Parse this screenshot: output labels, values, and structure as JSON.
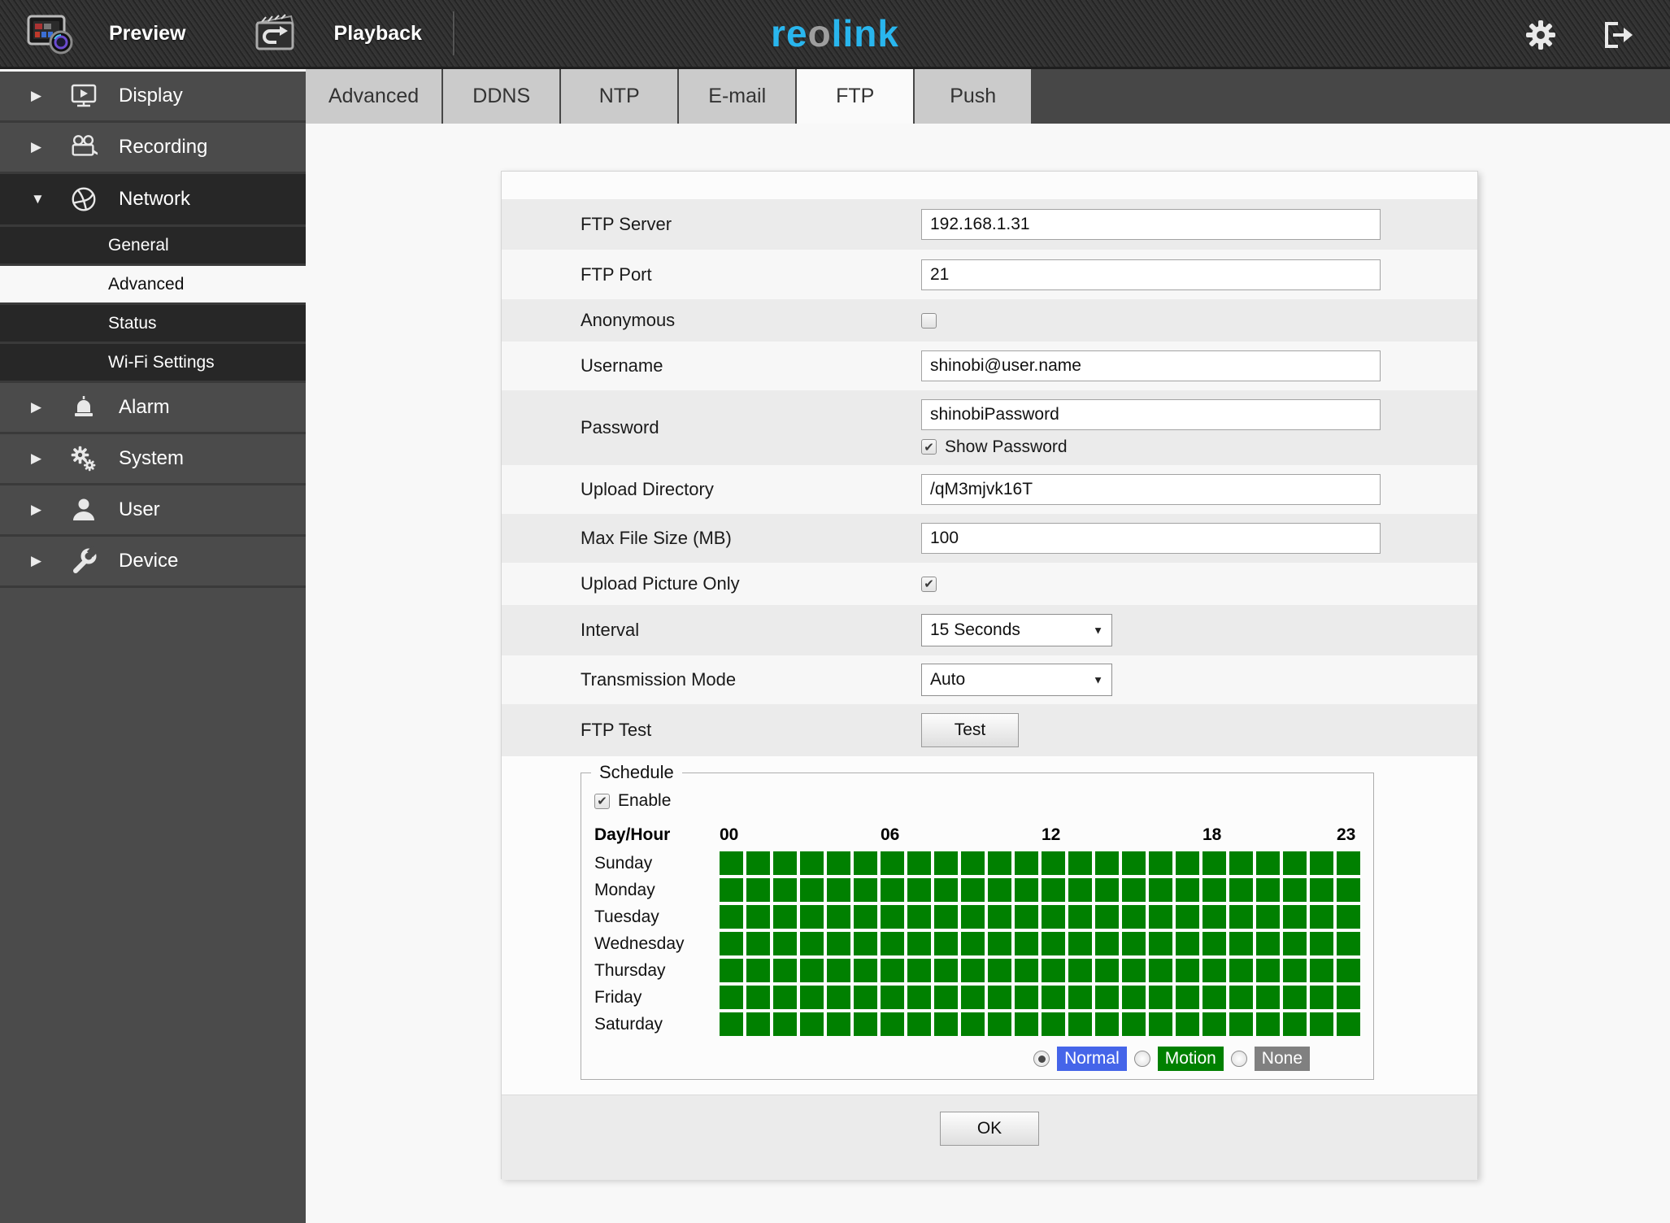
{
  "top_bar": {
    "menus": [
      {
        "label": "Preview",
        "icon": "preview-icon"
      },
      {
        "label": "Playback",
        "icon": "playback-icon"
      }
    ],
    "logo": {
      "pre": "re",
      "mid": "o",
      "post": "link"
    },
    "accent_color": "#29b6ee"
  },
  "sidebar": {
    "items": [
      {
        "label": "Display",
        "icon": "display-icon",
        "state": "collapsed"
      },
      {
        "label": "Recording",
        "icon": "recording-icon",
        "state": "collapsed"
      },
      {
        "label": "Network",
        "icon": "network-icon",
        "state": "expanded",
        "children": [
          {
            "label": "General",
            "selected": false
          },
          {
            "label": "Advanced",
            "selected": true
          },
          {
            "label": "Status",
            "selected": false
          },
          {
            "label": "Wi-Fi Settings",
            "selected": false
          }
        ]
      },
      {
        "label": "Alarm",
        "icon": "alarm-icon",
        "state": "collapsed"
      },
      {
        "label": "System",
        "icon": "system-icon",
        "state": "collapsed"
      },
      {
        "label": "User",
        "icon": "user-icon",
        "state": "collapsed"
      },
      {
        "label": "Device",
        "icon": "device-icon",
        "state": "collapsed"
      }
    ]
  },
  "tabs": [
    {
      "label": "Advanced",
      "active": false
    },
    {
      "label": "DDNS",
      "active": false
    },
    {
      "label": "NTP",
      "active": false
    },
    {
      "label": "E-mail",
      "active": false
    },
    {
      "label": "FTP",
      "active": true
    },
    {
      "label": "Push",
      "active": false
    }
  ],
  "form": {
    "rows": [
      {
        "id": "ftp-server",
        "label": "FTP Server",
        "type": "input",
        "value": "192.168.1.31"
      },
      {
        "id": "ftp-port",
        "label": "FTP Port",
        "type": "input",
        "value": "21"
      },
      {
        "id": "anonymous",
        "label": "Anonymous",
        "type": "checkbox",
        "checked": false
      },
      {
        "id": "username",
        "label": "Username",
        "type": "input",
        "value": "shinobi@user.name"
      },
      {
        "id": "password",
        "label": "Password",
        "type": "input-check",
        "value": "shinobiPassword",
        "check_label": "Show Password",
        "checked": true
      },
      {
        "id": "upload-directory",
        "label": "Upload Directory",
        "type": "input",
        "value": "/qM3mjvk16T"
      },
      {
        "id": "max-file-size",
        "label": "Max File Size (MB)",
        "type": "input",
        "value": "100"
      },
      {
        "id": "upload-picture-only",
        "label": "Upload Picture Only",
        "type": "checkbox",
        "checked": true
      },
      {
        "id": "interval",
        "label": "Interval",
        "type": "select",
        "value": "15 Seconds"
      },
      {
        "id": "transmission-mode",
        "label": "Transmission Mode",
        "type": "select",
        "value": "Auto"
      },
      {
        "id": "ftp-test",
        "label": "FTP Test",
        "type": "button",
        "button_label": "Test"
      }
    ],
    "ok_label": "OK"
  },
  "schedule": {
    "legend": "Schedule",
    "enable_label": "Enable",
    "enable_checked": true,
    "header": "Day/Hour",
    "hours": [
      {
        "label": "00",
        "col": 0
      },
      {
        "label": "06",
        "col": 6
      },
      {
        "label": "12",
        "col": 12
      },
      {
        "label": "18",
        "col": 18
      },
      {
        "label": "23",
        "col": 23
      }
    ],
    "days": [
      "Sunday",
      "Monday",
      "Tuesday",
      "Wednesday",
      "Thursday",
      "Friday",
      "Saturday"
    ],
    "grid": {
      "rows": 7,
      "cols": 24,
      "fill_mode": "Motion",
      "cell_color": "#008000"
    },
    "modes": [
      {
        "label": "Normal",
        "color": "#4565e9",
        "selected": true
      },
      {
        "label": "Motion",
        "color": "#008000",
        "selected": false
      },
      {
        "label": "None",
        "color": "#808080",
        "selected": false
      }
    ]
  }
}
